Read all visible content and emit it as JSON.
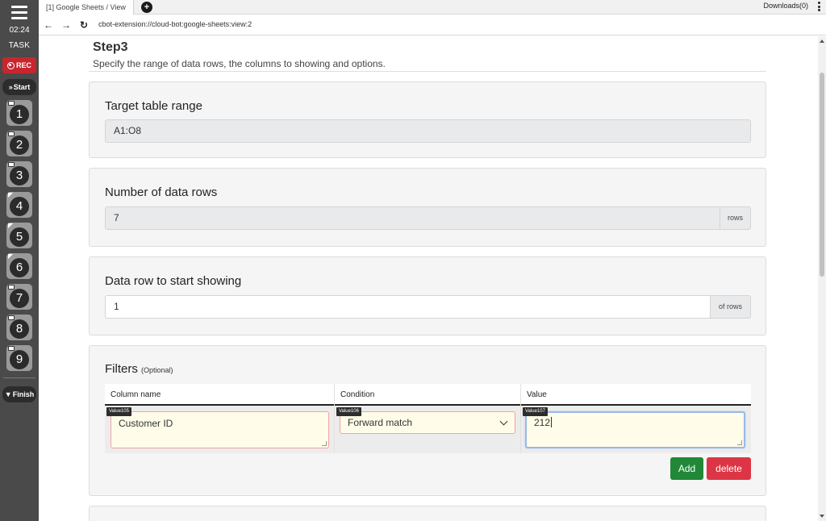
{
  "sidebar": {
    "time": "02:24",
    "task_label": "TASK",
    "rec_label": "REC",
    "start_label": "Start",
    "finish_label": "Finish",
    "steps": [
      {
        "number": "1"
      },
      {
        "number": "2"
      },
      {
        "number": "3"
      },
      {
        "number": "4"
      },
      {
        "number": "5"
      },
      {
        "number": "6"
      },
      {
        "number": "7"
      },
      {
        "number": "8"
      },
      {
        "number": "9"
      }
    ]
  },
  "browser": {
    "tab_title": "[1] Google Sheets / View",
    "new_tab": "+",
    "downloads": "Downloads(0)",
    "url": "cbot-extension://cloud-bot:google-sheets:view:2"
  },
  "page": {
    "step_title": "Step3",
    "step_description": "Specify the range of data rows, the columns to showing and options.",
    "target_range": {
      "label": "Target table range",
      "value": "A1:O8"
    },
    "data_rows": {
      "label": "Number of data rows",
      "value": "7",
      "unit": "rows"
    },
    "start_row": {
      "label": "Data row to start showing",
      "value": "1",
      "unit": "of rows"
    },
    "filters": {
      "label": "Filters",
      "optional": "(Optional)",
      "columns": [
        "Column name",
        "Condition",
        "Value"
      ],
      "row": {
        "column_tag": "Value105",
        "column_value": "Customer ID",
        "condition_tag": "Value106",
        "condition_value": "Forward match",
        "value_tag": "Value107",
        "value_value": "212"
      },
      "add_label": "Add",
      "delete_label": "delete"
    }
  },
  "colors": {
    "sidebar": "#4a4a4a",
    "rec": "#c8262f",
    "add": "#218838",
    "delete": "#dc3545",
    "field_bg_highlight": "#fffde9"
  }
}
